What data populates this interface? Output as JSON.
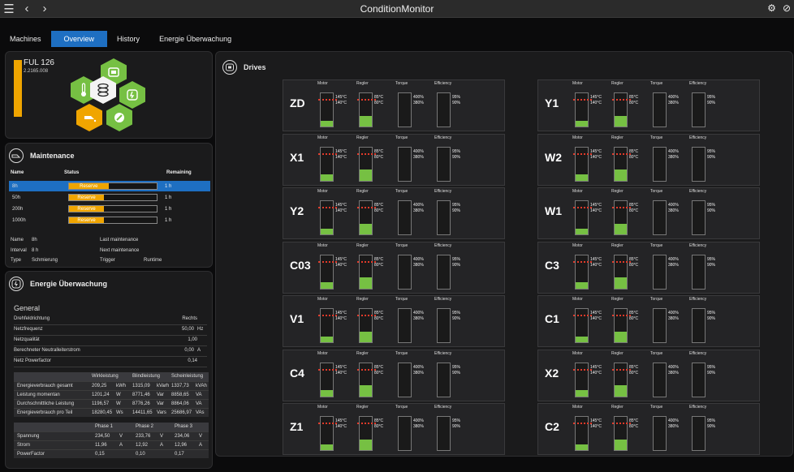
{
  "window": {
    "title": "ConditionMonitor",
    "menu_icon": "menu-icon",
    "back_icon": "chevron-left-icon",
    "forward_icon": "chevron-right-icon",
    "right_icons": [
      "gear-icon",
      "link-icon"
    ]
  },
  "nav": {
    "tabs": [
      {
        "label": "Machines",
        "active": false
      },
      {
        "label": "Overview",
        "active": true
      },
      {
        "label": "History",
        "active": false
      },
      {
        "label": "Energie Überwachung",
        "active": false
      }
    ]
  },
  "machine": {
    "name": "FUL 126",
    "id": "2.2165.008",
    "accent": "#f0a500"
  },
  "maintenance": {
    "title": "Maintenance",
    "cols": {
      "name": "Name",
      "status": "Status",
      "remaining": "Remaining"
    },
    "rows": [
      {
        "name": "8h",
        "status": "Reserve",
        "remaining": "1 h",
        "fill": 0.45,
        "selected": true
      },
      {
        "name": "50h",
        "status": "Reserve",
        "remaining": "1 h",
        "fill": 0.4,
        "selected": false
      },
      {
        "name": "200h",
        "status": "Reserve",
        "remaining": "1 h",
        "fill": 0.4,
        "selected": false
      },
      {
        "name": "1000h",
        "status": "Reserve",
        "remaining": "1 h",
        "fill": 0.4,
        "selected": false
      }
    ],
    "info": {
      "name_label": "Name",
      "name_value": "8h",
      "interval_label": "Interval",
      "interval_value": "8 h",
      "type_label": "Type",
      "type_value": "Schmierung",
      "last_label": "Last maintenance",
      "next_label": "Next maintenance",
      "trigger_label": "Trigger",
      "trigger_value": "Runtime"
    }
  },
  "energy": {
    "title": "Energie Überwachung",
    "general_title": "General",
    "props": [
      {
        "label": "Drehfeldrichtung",
        "value": "Rechts",
        "unit": ""
      },
      {
        "label": "Netzfrequenz",
        "value": "50,00",
        "unit": "Hz"
      },
      {
        "label": "Netzqualität",
        "value": "1,00",
        "unit": ""
      },
      {
        "label": "Berechneter Neutralleiterstrom",
        "value": "0,00",
        "unit": "A"
      },
      {
        "label": "Netz Powerfactor",
        "value": "0,14",
        "unit": ""
      }
    ],
    "table1": {
      "headers": [
        "Wirkleistung",
        "Blindleistung",
        "Scheinleistung"
      ],
      "rows": [
        {
          "label": "Energieverbrauch gesamt",
          "c1": "209,25",
          "u1": "kWh",
          "c2": "1315,09",
          "u2": "kVarh",
          "c3": "1337,73",
          "u3": "kVAh"
        },
        {
          "label": "Leistung momentan",
          "c1": "1201,24",
          "u1": "W",
          "c2": "8771,46",
          "u2": "Var",
          "c3": "8858,65",
          "u3": "VA"
        },
        {
          "label": "Durchschnittliche Leistung",
          "c1": "1196,57",
          "u1": "W",
          "c2": "8776,26",
          "u2": "Var",
          "c3": "8864,06",
          "u3": "VA"
        },
        {
          "label": "Energieverbrauch pro Teil",
          "c1": "18280,45",
          "u1": "Ws",
          "c2": "14411,65",
          "u2": "Vars",
          "c3": "25686,97",
          "u3": "VAs"
        }
      ]
    },
    "table2": {
      "headers": [
        "Phase 1",
        "Phase 2",
        "Phase 3"
      ],
      "rows": [
        {
          "label": "Spannung",
          "c1": "234,50",
          "u1": "V",
          "c2": "233,76",
          "u2": "V",
          "c3": "234,06",
          "u3": "V"
        },
        {
          "label": "Strom",
          "c1": "11,96",
          "u1": "A",
          "c2": "12,92",
          "u2": "A",
          "c3": "12,96",
          "u3": "A"
        },
        {
          "label": "PowerFactor",
          "c1": "0,15",
          "u1": "",
          "c2": "0,10",
          "u2": "",
          "c3": "0,17",
          "u3": ""
        }
      ]
    }
  },
  "drives": {
    "title": "Drives",
    "gauge_headers": [
      "Motor",
      "Regler",
      "Torque",
      "Efficiency"
    ],
    "values": {
      "motor_high": "145°C",
      "motor_low": "140°C",
      "regler_high": "85°C",
      "regler_low": "80°C",
      "torque_high": "400%",
      "torque_low": "380%",
      "eff_high": "95%",
      "eff_low": "90%"
    },
    "fill": {
      "motor": 0.18,
      "regler": 0.32,
      "torque": 0,
      "efficiency": 0
    },
    "colors": {
      "fill": "#76c043",
      "threshold": "#e23a2a"
    },
    "left": [
      "ZD",
      "X1",
      "Y2",
      "C03",
      "V1",
      "C4",
      "Z1"
    ],
    "right": [
      "Y1",
      "W2",
      "W1",
      "C3",
      "C1",
      "X2",
      "C2"
    ]
  }
}
